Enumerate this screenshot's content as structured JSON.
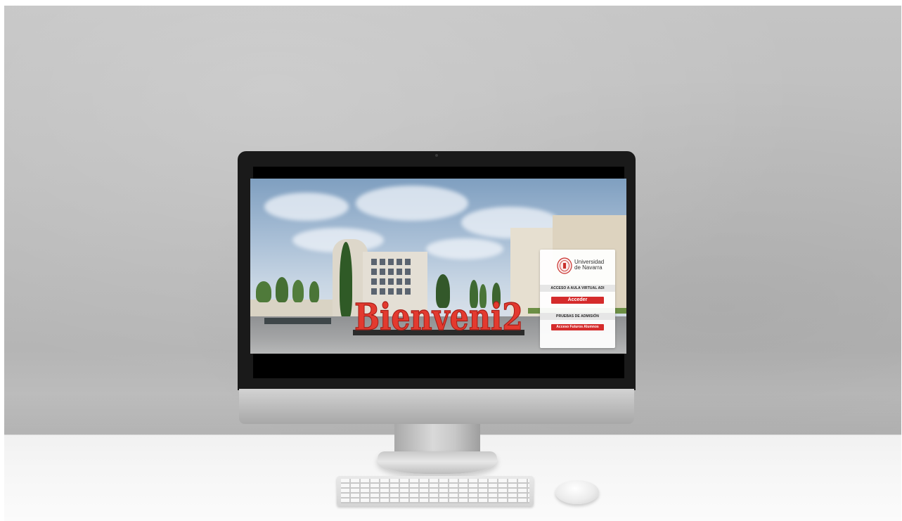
{
  "screen": {
    "sign_text": "Bienveni2",
    "login_panel": {
      "university_name_line1": "Universidad",
      "university_name_line2": "de Navarra",
      "section1_title": "ACCESO A AULA VIRTUAL ADI",
      "section1_button": "Acceder",
      "section2_title": "PRUEBAS DE ADMISIÓN",
      "section2_button": "Acceso Futuros Alumnos",
      "accent_color": "#d52b2b"
    }
  },
  "icons": {
    "logo": "university-seal-icon"
  }
}
